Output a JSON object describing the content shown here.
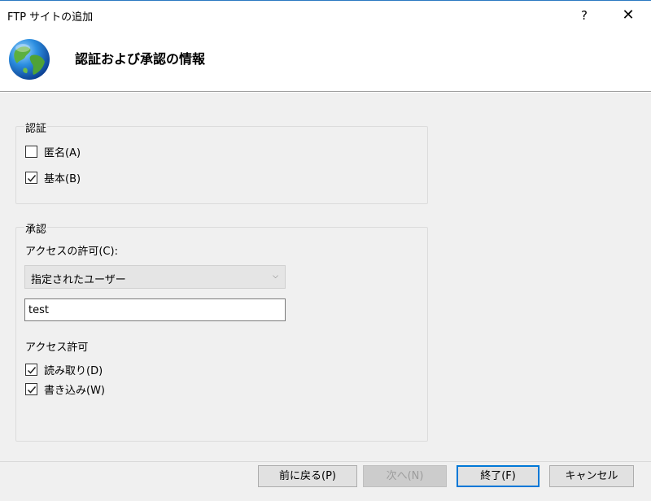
{
  "window": {
    "title": "FTP サイトの追加",
    "help_label": "?",
    "close_label": "✕"
  },
  "header": {
    "heading": "認証および承認の情報",
    "icon": "globe-icon"
  },
  "authentication": {
    "legend": "認証",
    "anonymous": {
      "label": "匿名(A)",
      "checked": false
    },
    "basic": {
      "label": "基本(B)",
      "checked": true
    }
  },
  "authorization": {
    "legend": "承認",
    "access_label": "アクセスの許可(C):",
    "access_select": {
      "value": "指定されたユーザー"
    },
    "user_input": {
      "value": "test"
    },
    "permissions_label": "アクセス許可",
    "read": {
      "label": "読み取り(D)",
      "checked": true
    },
    "write": {
      "label": "書き込み(W)",
      "checked": true
    }
  },
  "buttons": {
    "back": "前に戻る(P)",
    "next": "次へ(N)",
    "finish": "終了(F)",
    "cancel": "キャンセル"
  },
  "colors": {
    "accent": "#0078d7",
    "dialog_bg": "#f0f0f0"
  }
}
